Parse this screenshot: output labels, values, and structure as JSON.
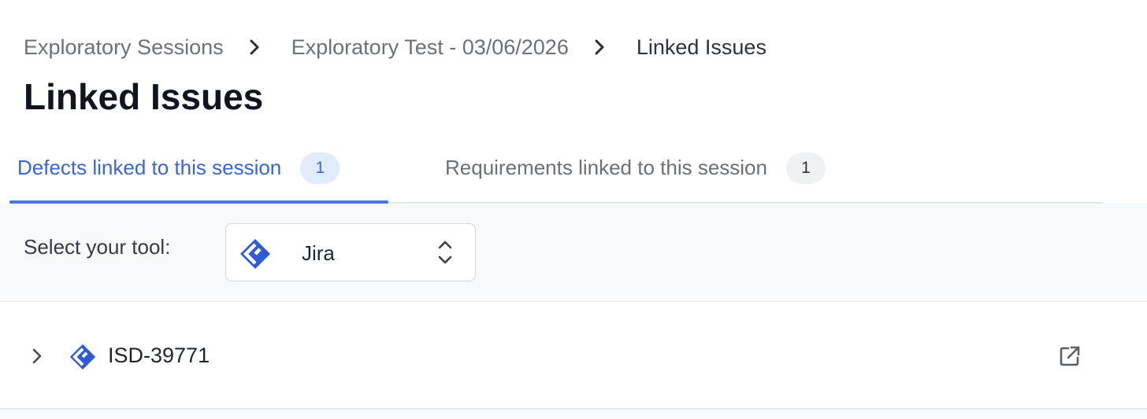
{
  "breadcrumb": {
    "items": [
      "Exploratory Sessions",
      "Exploratory Test - 03/06/2026"
    ],
    "current": "Linked Issues"
  },
  "page_title": "Linked Issues",
  "tabs": [
    {
      "label": "Defects linked to this session",
      "count": "1",
      "active": true
    },
    {
      "label": "Requirements linked to this session",
      "count": "1",
      "active": false
    }
  ],
  "tool_selector": {
    "label": "Select your tool:",
    "selected": "Jira",
    "selected_icon": "jira-logo-icon"
  },
  "issues": [
    {
      "key": "ISD-39771",
      "icon": "jira-logo-icon"
    }
  ],
  "colors": {
    "accent": "#3b64d4",
    "jira_blue": "#2f5bd3",
    "active_badge_bg": "#e2ebfb",
    "inactive_badge_bg": "#f0f1f3"
  }
}
